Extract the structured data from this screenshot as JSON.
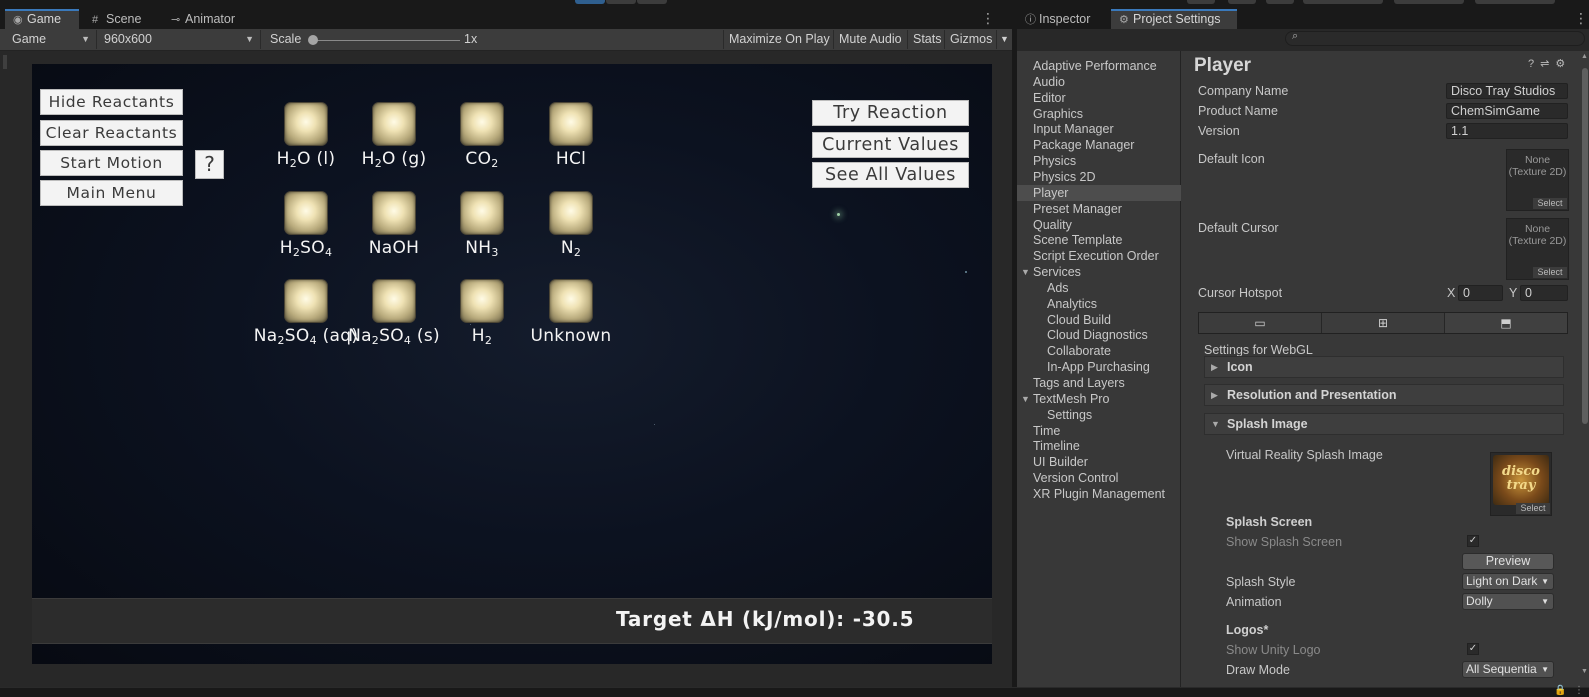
{
  "left_tabs": [
    {
      "label": "Game",
      "icon": "gamepad-icon"
    },
    {
      "label": "Scene",
      "icon": "grid-icon"
    },
    {
      "label": "Animator",
      "icon": "animator-icon"
    }
  ],
  "game_toolbar": {
    "display": "Game",
    "resolution": "960x600",
    "scale_label": "Scale",
    "scale_value": "1x",
    "maximize": "Maximize On Play",
    "mute": "Mute Audio",
    "stats": "Stats",
    "gizmos": "Gizmos"
  },
  "game": {
    "left_buttons": [
      "Hide Reactants",
      "Clear Reactants",
      "Start Motion",
      "Main Menu"
    ],
    "help": "?",
    "right_buttons": [
      "Try Reaction",
      "Current Values",
      "See All Values"
    ],
    "chemicals": [
      {
        "base": "H",
        "sub": "2",
        "rest": "O (l)"
      },
      {
        "base": "H",
        "sub": "2",
        "rest": "O (g)"
      },
      {
        "base": "CO",
        "sub": "2",
        "rest": ""
      },
      {
        "base": "HCl",
        "sub": "",
        "rest": ""
      },
      {
        "base": "H",
        "sub": "2",
        "rest": "SO",
        "sub2": "4"
      },
      {
        "base": "NaOH",
        "sub": "",
        "rest": ""
      },
      {
        "base": "NH",
        "sub": "3",
        "rest": ""
      },
      {
        "base": "N",
        "sub": "2",
        "rest": ""
      },
      {
        "base": "Na",
        "sub": "2",
        "rest": "SO",
        "sub2": "4",
        "rest2": " (aq)"
      },
      {
        "base": "Na",
        "sub": "2",
        "rest": "SO",
        "sub2": "4",
        "rest2": " (s)"
      },
      {
        "base": "H",
        "sub": "2",
        "rest": ""
      },
      {
        "base": "Unknown",
        "sub": "",
        "rest": ""
      }
    ],
    "target": "Target ΔH (kJ/mol): -30.5"
  },
  "right_tabs": [
    {
      "label": "Inspector",
      "icon": "info-icon"
    },
    {
      "label": "Project Settings",
      "icon": "gear-icon"
    }
  ],
  "nav": [
    "Adaptive Performance",
    "Audio",
    "Editor",
    "Graphics",
    "Input Manager",
    "Package Manager",
    "Physics",
    "Physics 2D",
    "Player",
    "Preset Manager",
    "Quality",
    "Scene Template",
    "Script Execution Order",
    "Services",
    "Ads",
    "Analytics",
    "Cloud Build",
    "Cloud Diagnostics",
    "Collaborate",
    "In-App Purchasing",
    "Tags and Layers",
    "TextMesh Pro",
    "Settings",
    "Time",
    "Timeline",
    "UI Builder",
    "Version Control",
    "XR Plugin Management"
  ],
  "player": {
    "title": "Player",
    "company_label": "Company Name",
    "company": "Disco Tray Studios",
    "product_label": "Product Name",
    "product": "ChemSimGame",
    "version_label": "Version",
    "version": "1.1",
    "default_icon": "Default Icon",
    "default_cursor": "Default Cursor",
    "none_texture": "None\n(Texture 2D)",
    "select": "Select",
    "hotspot": "Cursor Hotspot",
    "x_label": "X",
    "x": "0",
    "y_label": "Y",
    "y": "0",
    "settings_for": "Settings for WebGL",
    "icon_foldout": "Icon",
    "resolution_foldout": "Resolution and Presentation",
    "splash_foldout": "Splash Image",
    "vr_splash": "Virtual Reality Splash Image",
    "logo_text": "disco tray",
    "splash_screen": "Splash Screen",
    "show_splash": "Show Splash Screen",
    "preview": "Preview",
    "splash_style": "Splash Style",
    "splash_style_val": "Light on Dark",
    "animation": "Animation",
    "animation_val": "Dolly",
    "logos": "Logos*",
    "show_unity_logo": "Show Unity Logo",
    "draw_mode": "Draw Mode",
    "draw_mode_val": "All Sequentia"
  }
}
